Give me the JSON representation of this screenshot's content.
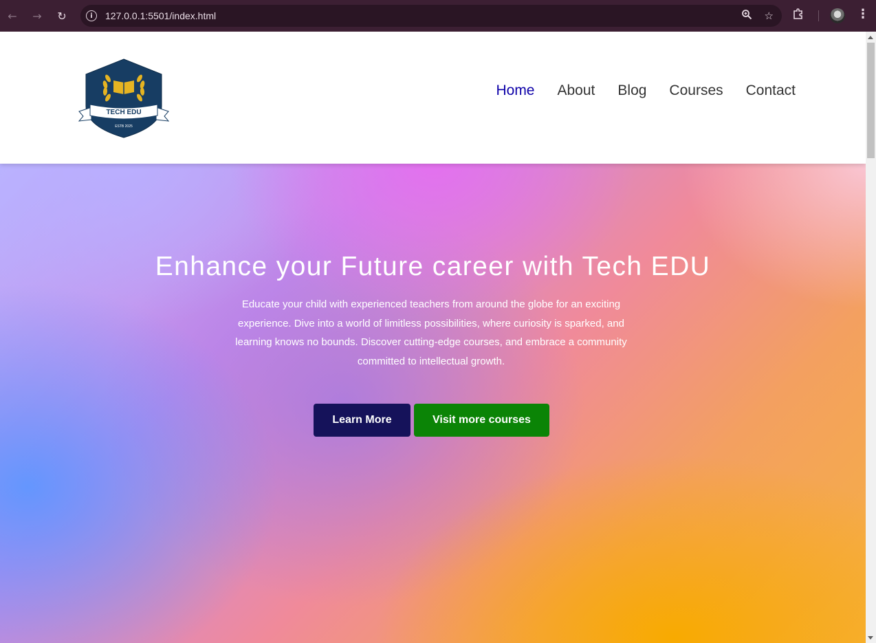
{
  "browser": {
    "url": "127.0.0.1:5501/index.html",
    "back_icon": "arrow-left-icon",
    "forward_icon": "arrow-right-icon",
    "reload_icon": "reload-icon",
    "menu_icon": "kebab-menu-icon"
  },
  "site": {
    "logo": {
      "top_text": "TECH EDU",
      "bottom_text": "ESTB 2025"
    },
    "nav": {
      "items": [
        {
          "label": "Home",
          "active": true
        },
        {
          "label": "About",
          "active": false
        },
        {
          "label": "Blog",
          "active": false
        },
        {
          "label": "Courses",
          "active": false
        },
        {
          "label": "Contact",
          "active": false
        }
      ]
    }
  },
  "hero": {
    "title": "Enhance your Future career with Tech EDU",
    "description": "Educate your child with experienced teachers from around the globe for an exciting experience. Dive into a world of limitless possibilities, where curiosity is sparked, and learning knows no bounds. Discover cutting-edge courses, and embrace a community committed to intellectual growth.",
    "buttons": {
      "learn_more": "Learn More",
      "visit_courses": "Visit more courses"
    }
  },
  "colors": {
    "nav_active": "#0d00a8",
    "learn_button": "#15125a",
    "visit_button": "#0b8406",
    "logo_shield": "#173d63",
    "logo_gold": "#e6b422"
  }
}
